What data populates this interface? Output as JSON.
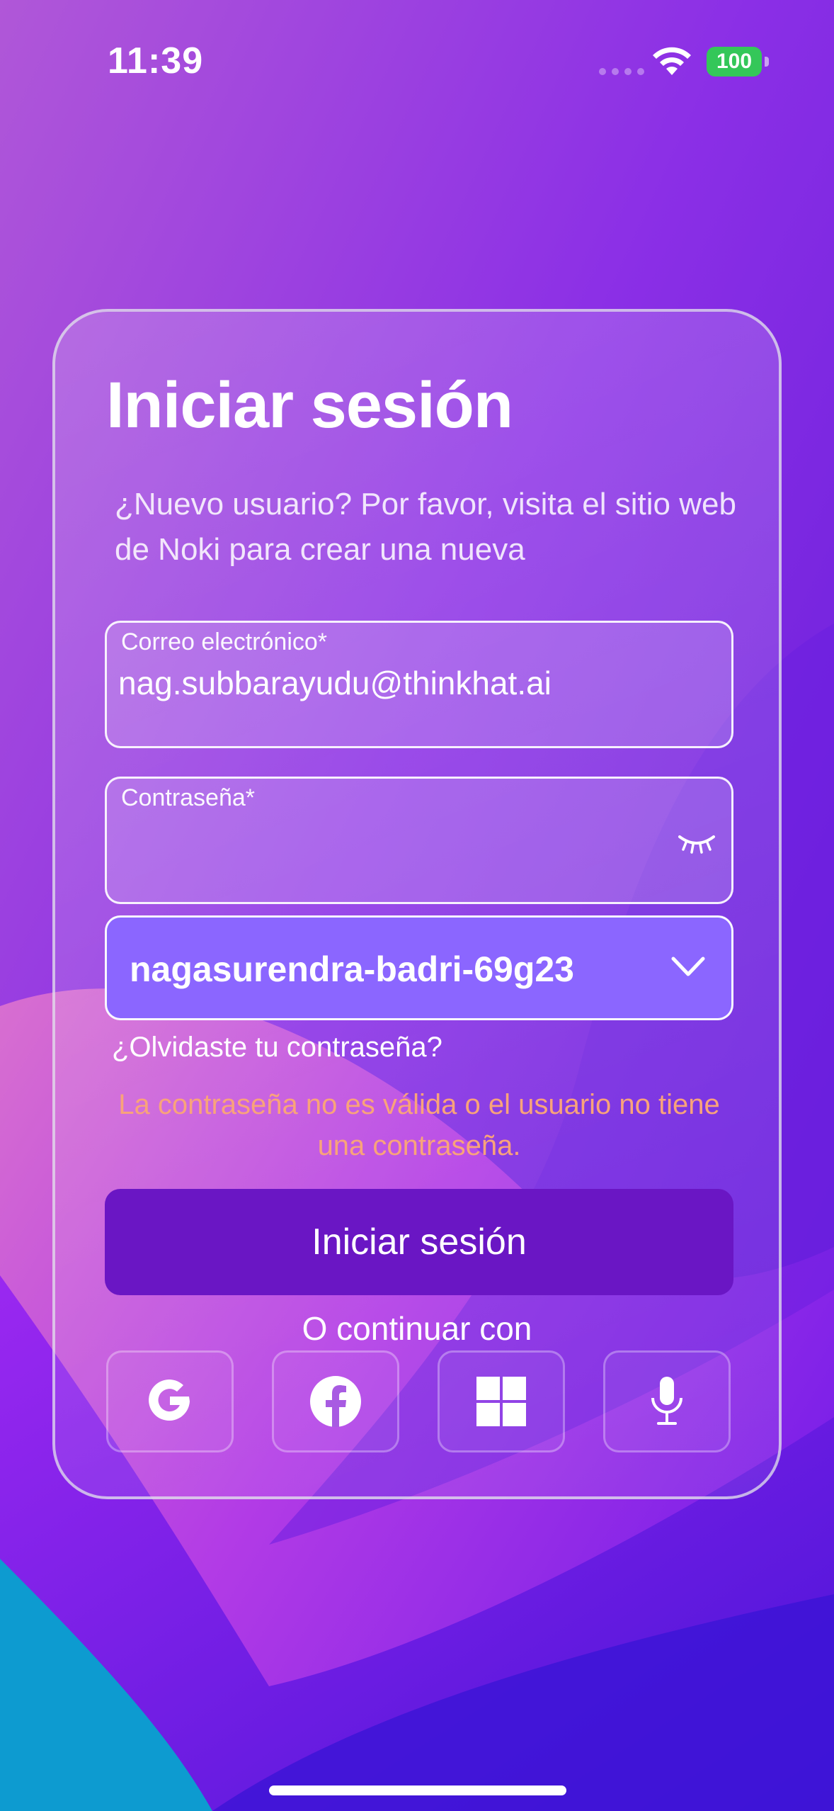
{
  "status_bar": {
    "time": "11:39",
    "battery": "100"
  },
  "login": {
    "title": "Iniciar sesión",
    "subtitle": "¿Nuevo usuario? Por favor, visita el sitio web de Noki para crear una nueva",
    "email": {
      "label": "Correo electrónico*",
      "value": "nag.subbarayudu@thinkhat.ai"
    },
    "password": {
      "label": "Contraseña*",
      "value": ""
    },
    "workspace": {
      "selected": "nagasurendra-badri-69g23"
    },
    "forgot_password": "¿Olvidaste tu contraseña?",
    "error": "La contraseña no es válida o el usuario no tiene una contraseña.",
    "submit_label": "Iniciar sesión",
    "continue_with": "O continuar con"
  },
  "social_buttons": [
    {
      "icon": "google-icon"
    },
    {
      "icon": "facebook-icon"
    },
    {
      "icon": "windows-icon"
    },
    {
      "icon": "microphone-icon"
    }
  ]
}
